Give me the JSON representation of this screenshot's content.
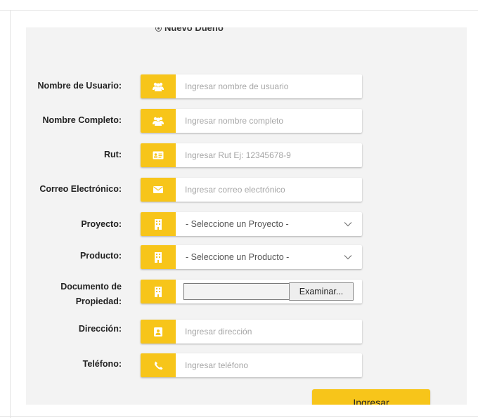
{
  "form": {
    "owner_option": "Nuevo Dueño",
    "fields": {
      "username": {
        "label": "Nombre de Usuario:",
        "placeholder": "Ingresar nombre de usuario",
        "icon": "users-icon"
      },
      "fullname": {
        "label": "Nombre Completo:",
        "placeholder": "Ingresar nombre completo",
        "icon": "users-icon"
      },
      "rut": {
        "label": "Rut:",
        "placeholder": "Ingresar Rut Ej: 12345678-9",
        "icon": "id-card-icon"
      },
      "email": {
        "label": "Correo Electrónico:",
        "placeholder": "Ingresar correo electrónico",
        "icon": "envelope-icon"
      },
      "project": {
        "label": "Proyecto:",
        "value": "- Seleccione un Proyecto -",
        "icon": "building-icon"
      },
      "product": {
        "label": "Producto:",
        "value": "- Seleccione un Producto -",
        "icon": "building-icon"
      },
      "document": {
        "label_line1": "Documento de",
        "label_line2": "Propiedad:",
        "button": "Examinar...",
        "icon": "building-icon"
      },
      "address": {
        "label": "Dirección:",
        "placeholder": "Ingresar dirección",
        "icon": "address-card-icon"
      },
      "phone": {
        "label": "Teléfono:",
        "placeholder": "Ingresar teléfono",
        "icon": "phone-icon"
      }
    },
    "submit_label": "Ingresar"
  },
  "colors": {
    "accent": "#f7c51a",
    "panel": "#f3f3f3"
  }
}
